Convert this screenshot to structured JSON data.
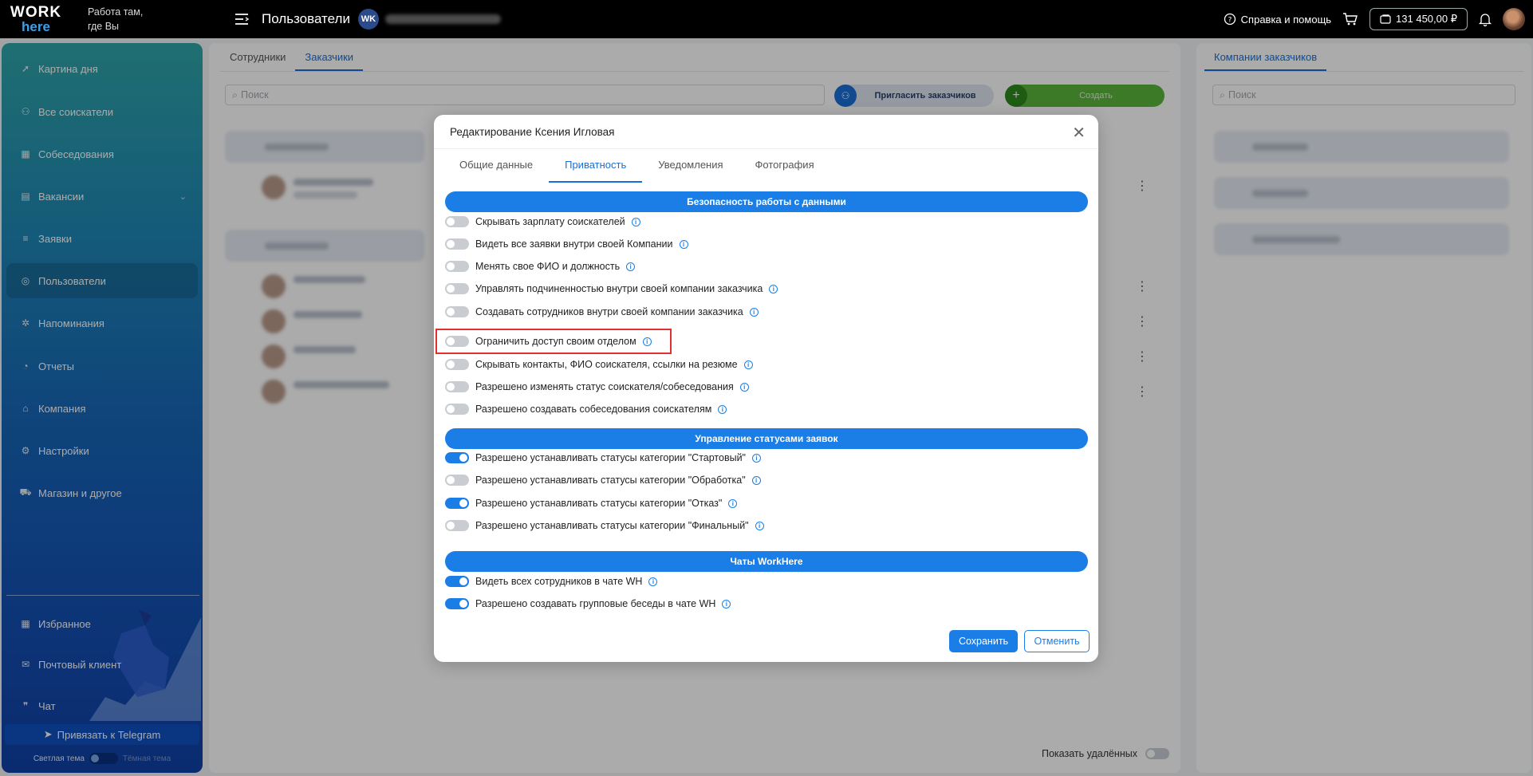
{
  "topbar": {
    "logo_top": "WORK",
    "logo_bottom": "here",
    "tagline_1": "Работа там,",
    "tagline_2": "где Вы",
    "page_title": "Пользователи",
    "company_badge": "WK",
    "help_label": "Справка и помощь",
    "balance": "131 450,00 ₽"
  },
  "sidebar": {
    "items": [
      {
        "label": "Картина дня",
        "icon": "rocket-icon"
      },
      {
        "label": "Все соискатели",
        "icon": "people-icon"
      },
      {
        "label": "Собеседования",
        "icon": "calendar-icon"
      },
      {
        "label": "Вакансии",
        "icon": "card-icon"
      },
      {
        "label": "Заявки",
        "icon": "list-icon"
      },
      {
        "label": "Пользователи",
        "icon": "user-circle-icon"
      },
      {
        "label": "Напоминания",
        "icon": "gear-icon"
      },
      {
        "label": "Отчеты",
        "icon": "chart-icon"
      },
      {
        "label": "Компания",
        "icon": "home-icon"
      },
      {
        "label": "Настройки",
        "icon": "settings-icon"
      },
      {
        "label": "Магазин и другое",
        "icon": "cart-icon"
      }
    ],
    "bottom_items": [
      {
        "label": "Избранное",
        "icon": "grid-icon"
      },
      {
        "label": "Почтовый клиент",
        "icon": "mail-icon"
      },
      {
        "label": "Чат",
        "icon": "chat-icon"
      }
    ],
    "telegram_label": "Привязать к Telegram",
    "theme_light": "Светлая тема",
    "theme_dark": "Тёмная тема"
  },
  "main": {
    "tabs": [
      {
        "label": "Сотрудники"
      },
      {
        "label": "Заказчики"
      }
    ],
    "search_placeholder": "Поиск",
    "invite_label": "Пригласить заказчиков",
    "create_label": "Создать",
    "show_deleted_label": "Показать удалённых"
  },
  "right": {
    "tab_label": "Компании заказчиков",
    "search_placeholder": "Поиск"
  },
  "modal": {
    "title": "Редактирование Ксения Игловая",
    "tabs": [
      {
        "label": "Общие данные"
      },
      {
        "label": "Приватность"
      },
      {
        "label": "Уведомления"
      },
      {
        "label": "Фотография"
      }
    ],
    "sections": [
      {
        "title": "Безопасность работы с данными",
        "options": [
          {
            "label": "Скрывать зарплату соискателей",
            "on": false
          },
          {
            "label": "Видеть все заявки внутри своей Компании",
            "on": false
          },
          {
            "label": "Менять свое ФИО и должность",
            "on": false
          },
          {
            "label": "Управлять подчиненностью внутри своей компании заказчика",
            "on": false
          },
          {
            "label": "Создавать сотрудников внутри своей компании заказчика",
            "on": false
          },
          {
            "label": "Ограничить доступ своим отделом",
            "on": false
          },
          {
            "label": "Скрывать контакты, ФИО соискателя, ссылки на резюме",
            "on": false
          },
          {
            "label": "Разрешено изменять статус соискателя/собеседования",
            "on": false
          },
          {
            "label": "Разрешено создавать собеседования соискателям",
            "on": false
          }
        ]
      },
      {
        "title": "Управление статусами заявок",
        "options": [
          {
            "label": "Разрешено устанавливать статусы категории \"Стартовый\"",
            "on": true
          },
          {
            "label": "Разрешено устанавливать статусы категории \"Обработка\"",
            "on": false
          },
          {
            "label": "Разрешено устанавливать статусы категории \"Отказ\"",
            "on": true
          },
          {
            "label": "Разрешено устанавливать статусы категории \"Финальный\"",
            "on": false
          }
        ]
      },
      {
        "title": "Чаты WorkHere",
        "options": [
          {
            "label": "Видеть всех сотрудников в чате WH",
            "on": true
          },
          {
            "label": "Разрешено создавать групповые беседы в чате WH",
            "on": true
          }
        ]
      }
    ],
    "save_label": "Сохранить",
    "cancel_label": "Отменить"
  },
  "colors": {
    "accent": "#1a7ee6",
    "highlight": "#e03030",
    "create_green": "#5bb73d"
  }
}
